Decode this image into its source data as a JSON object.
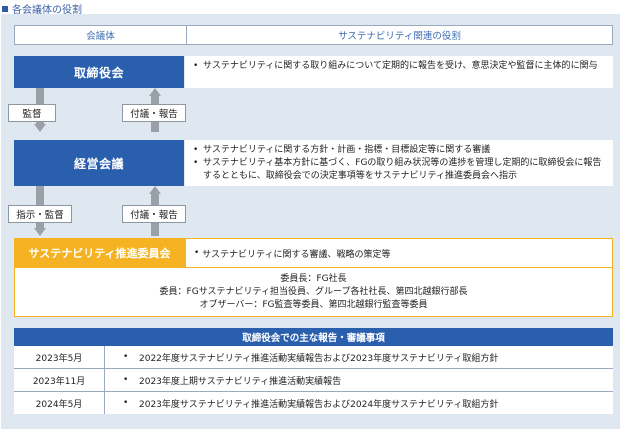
{
  "heading": "各会議体の役割",
  "headers": {
    "col1": "会議体",
    "col2": "サステナビリティ関連の役割"
  },
  "board": {
    "name": "取締役会",
    "desc": [
      "サステナビリティに関する取り組みについて定期的に報告を受け、意思決定や監督に主体的に関与"
    ]
  },
  "arrows1": {
    "down": "監督",
    "up": "付議・報告"
  },
  "mgmt": {
    "name": "経営会議",
    "desc": [
      "サステナビリティに関する方針・計画・指標・目標設定等に関する審議",
      "サステナビリティ基本方針に基づく、FGの取り組み状況等の進捗を管理し定期的に取締役会に報告するとともに、取締役会での決定事項等をサステナビリティ推進委員会へ指示"
    ]
  },
  "arrows2": {
    "down": "指示・監督",
    "up": "付議・報告"
  },
  "committee": {
    "name": "サステナビリティ推進委員会",
    "desc": "サステナビリティに関する審議、戦略の策定等",
    "members": [
      "委員長：FG社長",
      "委員：FGサステナビリティ担当役員、グループ各社社長、第四北越銀行部長",
      "オブザーバー：FG監査等委員、第四北越銀行監査等委員"
    ]
  },
  "reports": {
    "title": "取締役会での主な報告・審議事項",
    "rows": [
      {
        "date": "2023年5月",
        "bullet": "•",
        "item": "2022年度サステナビリティ推進活動実績報告および2023年度サステナビリティ取組方針"
      },
      {
        "date": "2023年11月",
        "bullet": "•",
        "item": "2023年度上期サステナビリティ推進活動実績報告"
      },
      {
        "date": "2024年5月",
        "bullet": "•",
        "item": "2023年度サステナビリティ推進活動実績報告および2024年度サステナビリティ取組方針"
      }
    ]
  },
  "colors": {
    "blue": "#2a5fae",
    "orange": "#f5b323",
    "panel": "#dfe7f1",
    "arrow": "#9aa0a8"
  }
}
